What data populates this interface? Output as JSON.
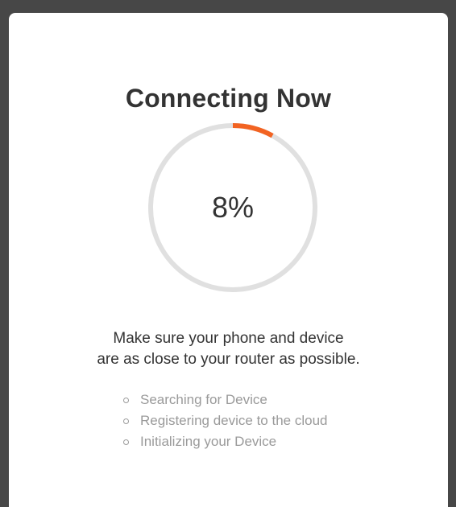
{
  "dialog": {
    "title": "Connecting Now",
    "progress": {
      "percent_label": "8%",
      "value": 0.08,
      "track_color": "#e0e0e0",
      "fill_color": "#f26322"
    },
    "hint_line1": "Make sure your phone and device",
    "hint_line2": "are as close to your router as possible.",
    "steps": [
      "Searching for Device",
      "Registering device to the cloud",
      "Initializing your Device"
    ]
  }
}
